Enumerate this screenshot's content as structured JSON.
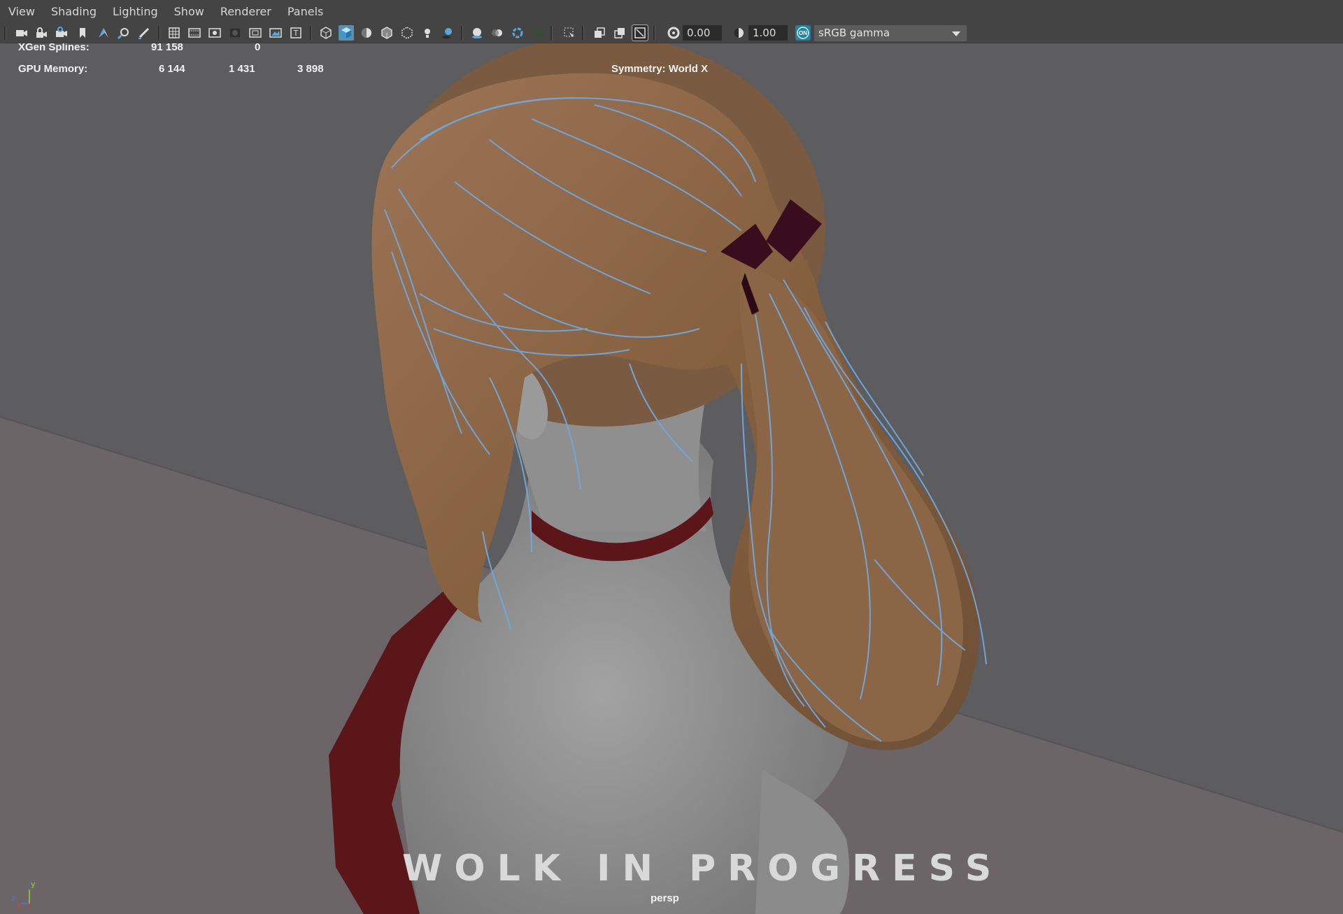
{
  "menubar": {
    "items": [
      "View",
      "Shading",
      "Lighting",
      "Show",
      "Renderer",
      "Panels"
    ]
  },
  "toolbar": {
    "icons": [
      "select-camera-icon",
      "lock-camera-icon",
      "camera-attributes-icon",
      "bookmark-icon",
      "image-plane-icon",
      "2d-pan-zoom-icon",
      "grease-pencil-icon",
      "grid-icon",
      "film-gate-icon",
      "resolution-gate-icon",
      "gate-mask-icon",
      "field-chart-icon",
      "safe-action-icon",
      "safe-title-icon",
      "wireframe-icon",
      "smooth-shade-icon",
      "use-default-material-icon",
      "wireframe-on-shaded-icon",
      "xray-icon",
      "use-all-lights-icon",
      "shadows-icon",
      "screen-space-ao-icon",
      "motion-blur-icon",
      "multisample-aa-icon",
      "depth-of-field-icon",
      "isolate-select-icon",
      "xray-joints-icon",
      "xray-active-components-icon",
      "camera-toggle-icon",
      "exposure-icon",
      "gamma-icon",
      "color-management-icon"
    ],
    "exposure_value": "0.00",
    "gamma_value": "1.00",
    "color_management_badge": "ON",
    "view_transform": "sRGB gamma"
  },
  "hud": {
    "xgen_label": "XGen Splines:",
    "xgen_values": [
      "91 158",
      "0"
    ],
    "gpu_label": "GPU Memory:",
    "gpu_values": [
      "6 144",
      "1 431",
      "3 898"
    ],
    "symmetry": "Symmetry: World X"
  },
  "scene": {
    "watermark": "WOLK IN PROGRESS",
    "camera": "persp",
    "axis_labels": [
      "y",
      "z",
      "x"
    ],
    "colors": {
      "viewport_bg": "#5d5c5e",
      "floor": "#6b6567",
      "hair": "#8a6546",
      "guide_curves": "#6fa8e0",
      "skin": "#8d8d8d",
      "dress": "#5a1618",
      "bow": "#3a0d1e"
    }
  }
}
